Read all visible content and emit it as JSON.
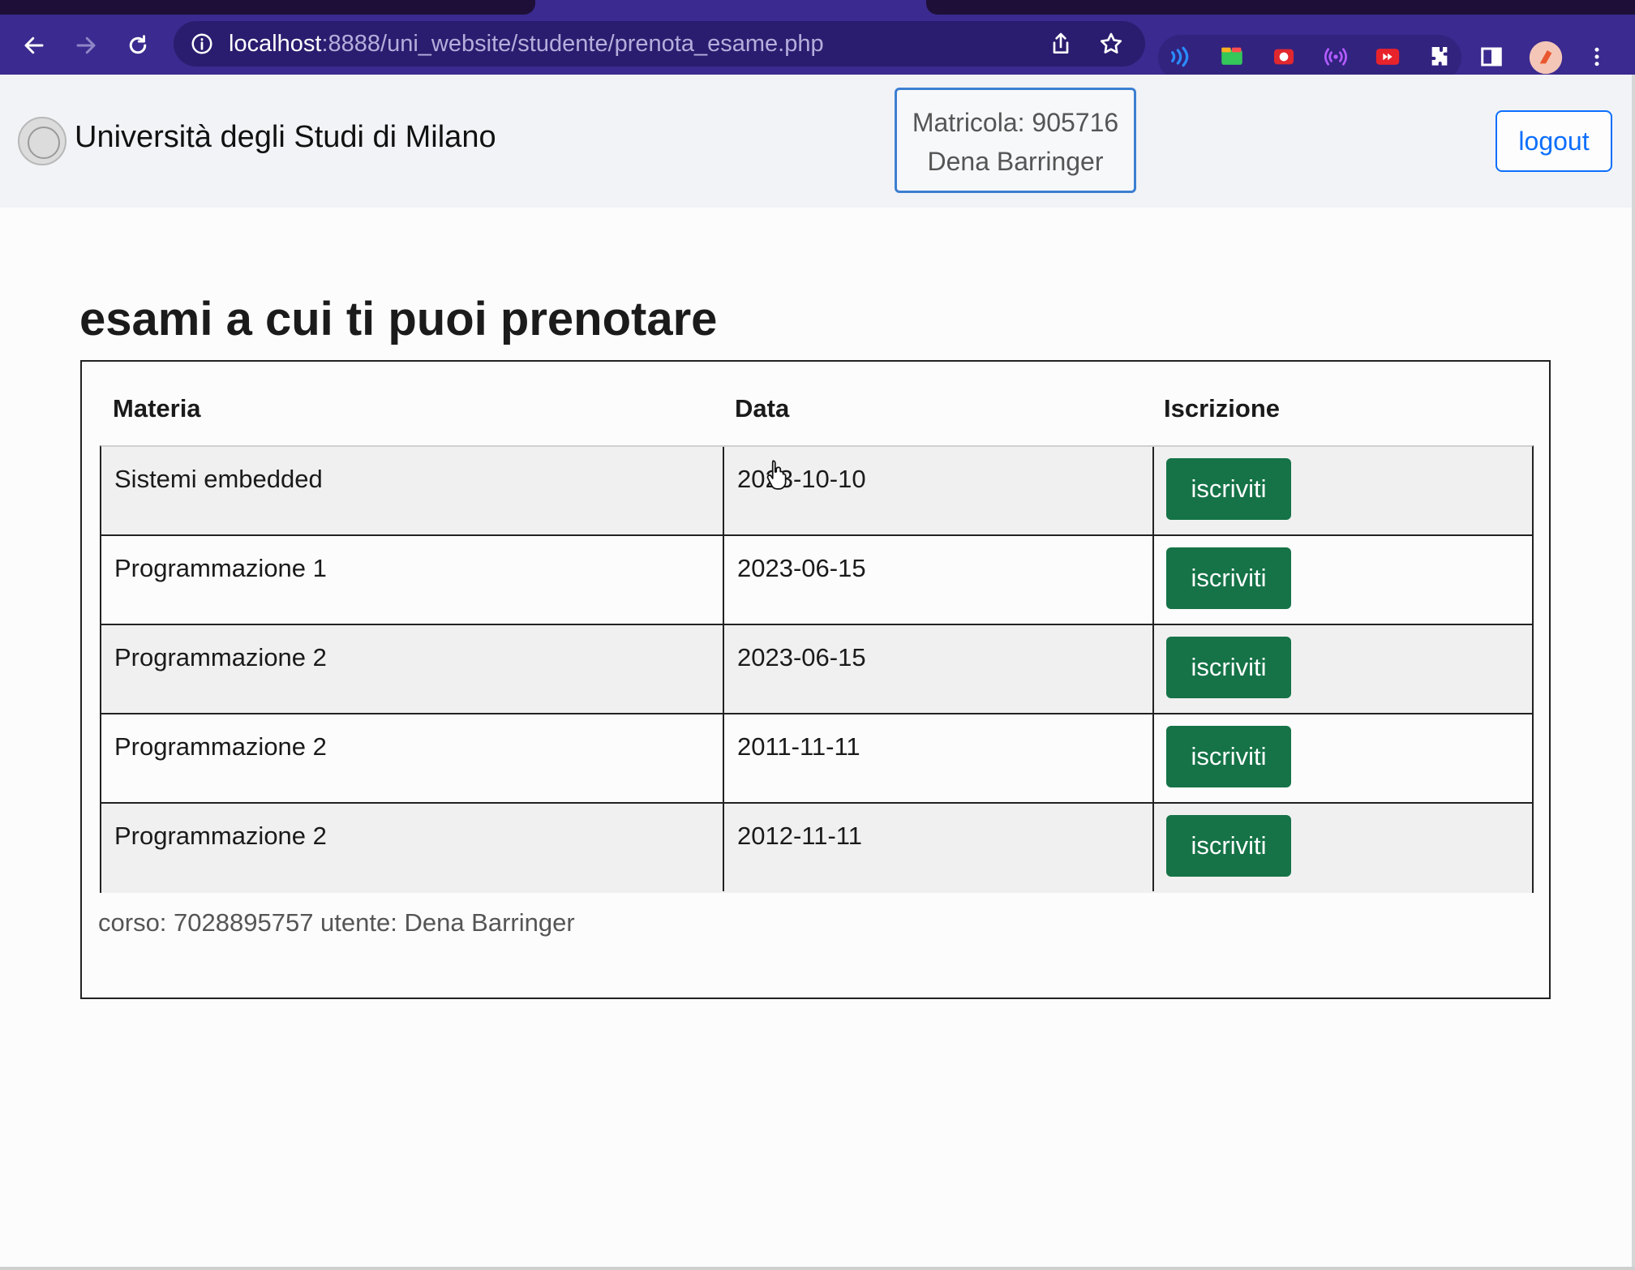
{
  "browser": {
    "url_host": "localhost",
    "url_path": ":8888/uni_website/studente/prenota_esame.php",
    "icons": [
      "back-icon",
      "forward-icon",
      "reload-icon",
      "info-icon",
      "share-icon",
      "bookmark-star-icon",
      "extension-icons",
      "puzzle-icon",
      "sidepanel-icon",
      "profile-avatar",
      "menu-dots-icon"
    ]
  },
  "header": {
    "brand": "Università degli Studi di Milano",
    "matricola": "Matricola: 905716",
    "user_name": "Dena Barringer",
    "logout_label": "logout"
  },
  "main": {
    "title": "esami a cui ti puoi prenotare",
    "columns": [
      "Materia",
      "Data",
      "Iscrizione"
    ],
    "rows": [
      {
        "materia": "Sistemi embedded",
        "data": "2023-10-10",
        "action": "iscriviti"
      },
      {
        "materia": "Programmazione 1",
        "data": "2023-06-15",
        "action": "iscriviti"
      },
      {
        "materia": "Programmazione 2",
        "data": "2023-06-15",
        "action": "iscriviti"
      },
      {
        "materia": "Programmazione 2",
        "data": "2011-11-11",
        "action": "iscriviti"
      },
      {
        "materia": "Programmazione 2",
        "data": "2012-11-11",
        "action": "iscriviti"
      }
    ],
    "footer": "corso: 7028895757 utente: Dena Barringer"
  },
  "colors": {
    "chrome": "#3b2a8f",
    "button_green": "#157347",
    "logout_blue": "#0d6efd",
    "user_box_border": "#3c7fd1"
  }
}
